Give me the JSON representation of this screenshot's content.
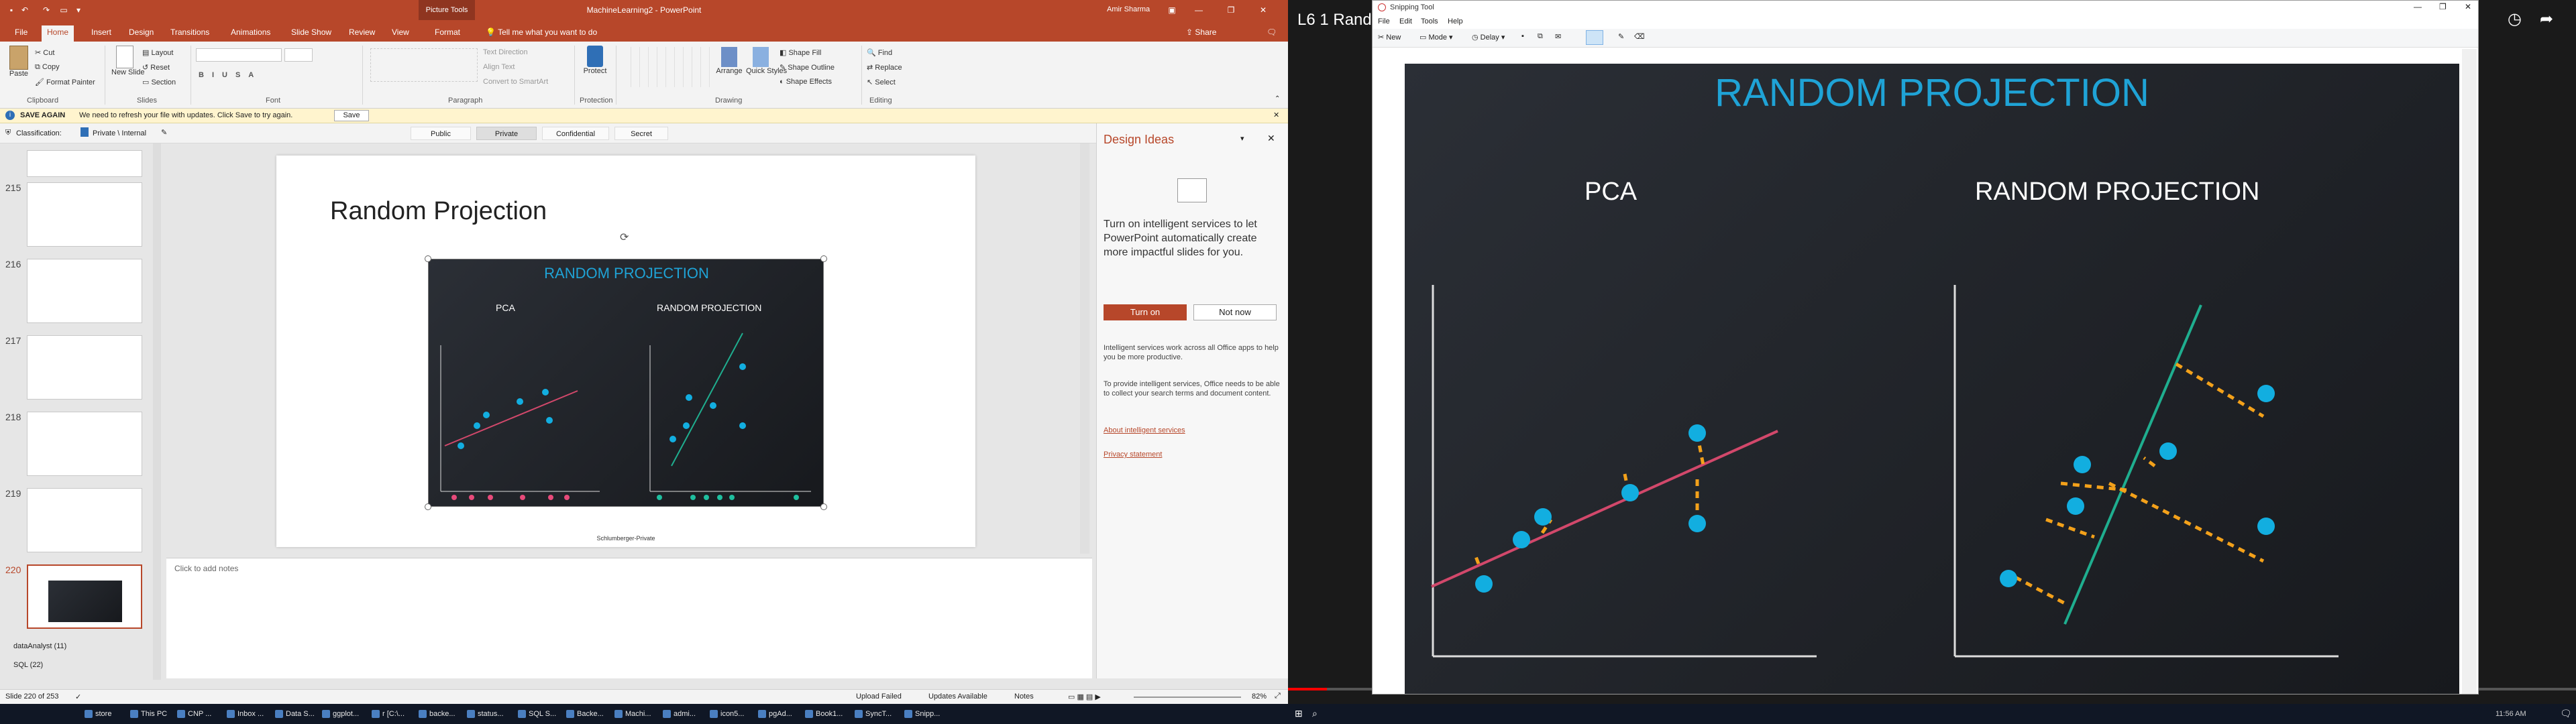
{
  "ppt": {
    "title": "MachineLearning2 - PowerPoint",
    "picture_tools": "Picture Tools",
    "user": "Amir Sharma",
    "share": "Share",
    "tabs": [
      "File",
      "Home",
      "Insert",
      "Design",
      "Transitions",
      "Animations",
      "Slide Show",
      "Review",
      "View",
      "Format"
    ],
    "tell_me": "Tell me what you want to do",
    "ribbon": {
      "paste": "Paste",
      "cut": "Cut",
      "copy": "Copy",
      "format_painter": "Format Painter",
      "new_slide": "New Slide",
      "layout": "Layout",
      "reset": "Reset",
      "section": "Section",
      "text_direction": "Text Direction",
      "align_text": "Align Text",
      "convert_smartart": "Convert to SmartArt",
      "protect": "Protect",
      "arrange": "Arrange",
      "quick_styles": "Quick Styles",
      "shape_fill": "Shape Fill",
      "shape_outline": "Shape Outline",
      "shape_effects": "Shape Effects",
      "find": "Find",
      "replace": "Replace",
      "select": "Select",
      "groups": [
        "Clipboard",
        "Slides",
        "Font",
        "Paragraph",
        "Protection",
        "Drawing",
        "Editing"
      ]
    },
    "message": {
      "title": "SAVE AGAIN",
      "text": "We need to refresh your file with updates. Click Save to try again.",
      "button": "Save"
    },
    "classification": {
      "label": "Classification:",
      "value": "Private \\ Internal",
      "options": [
        "Public",
        "Private",
        "Confidential",
        "Secret"
      ]
    },
    "thumbs": [
      "215",
      "216",
      "217",
      "218",
      "219",
      "220"
    ],
    "sections": [
      "dataAnalyst (11)",
      "SQL (22)"
    ],
    "slide": {
      "title": "Random Projection",
      "img_title": "RANDOM PROJECTION",
      "pca": "PCA",
      "rp": "RANDOM PROJECTION",
      "footer": "Schlumberger-Private"
    },
    "notes_placeholder": "Click to add notes",
    "design": {
      "title": "Design Ideas",
      "promo": "Turn on intelligent services to let PowerPoint automatically create more impactful slides for you.",
      "turn_on": "Turn on",
      "not_now": "Not now",
      "info1": "Intelligent services work across all Office apps to help you be more productive.",
      "info2": "To provide intelligent services, Office needs to be able to collect your search terms and document content.",
      "link1": "About intelligent services",
      "link2": "Privacy statement"
    },
    "status": {
      "slide": "Slide 220 of 253",
      "upload": "Upload Failed",
      "updates": "Updates Available",
      "notes": "Notes",
      "zoom": "82%"
    }
  },
  "snip": {
    "video_title": "L6 1 Rand",
    "window_title": "Snipping Tool",
    "menu": [
      "File",
      "Edit",
      "Tools",
      "Help"
    ],
    "toolbar": {
      "new": "New",
      "mode": "Mode",
      "delay": "Delay"
    },
    "image": {
      "title": "RANDOM PROJECTION",
      "pca": "PCA",
      "rp": "RANDOM PROJECTION"
    },
    "clock": "11:56 AM"
  },
  "taskbar": [
    "store",
    "This PC",
    "CNP ...",
    "Inbox ...",
    "Data S...",
    "ggplot...",
    "r [C:\\...",
    "backe...",
    "status...",
    "SQL S...",
    "Backe...",
    "Machi...",
    "admi...",
    "icon5...",
    "pgAd...",
    "Book1...",
    "SyncT...",
    "Snipp..."
  ],
  "taskbar_clock": "11:56 AM",
  "colors": {
    "ppt_accent": "#b7472a",
    "image_title": "#1fa3d6",
    "points": "#12aee0",
    "pca_line": "#d2486b",
    "rp_line": "#1fae8f",
    "residual": "#f3a11a"
  }
}
